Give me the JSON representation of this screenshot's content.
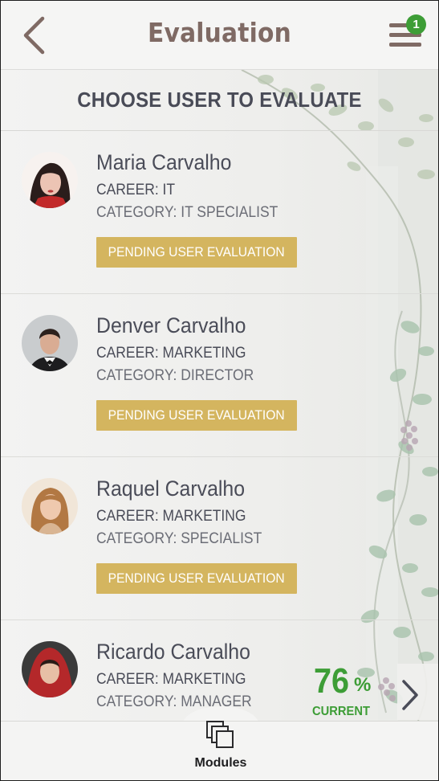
{
  "header": {
    "title": "Evaluation",
    "menu_badge_count": "1"
  },
  "section": {
    "title": "CHOOSE USER TO EVALUATE"
  },
  "users": [
    {
      "name": "Maria Carvalho",
      "career": "CAREER: IT",
      "category": "CATEGORY: IT SPECIALIST",
      "status": "PENDING USER EVALUATION"
    },
    {
      "name": "Denver Carvalho",
      "career": "CAREER: MARKETING",
      "category": "CATEGORY: DIRECTOR",
      "status": "PENDING USER EVALUATION"
    },
    {
      "name": "Raquel Carvalho",
      "career": "CAREER: MARKETING",
      "category": "CATEGORY: SPECIALIST",
      "status": "PENDING USER EVALUATION"
    },
    {
      "name": "Ricardo Carvalho",
      "career": "CAREER: MARKETING",
      "category": "CATEGORY: MANAGER"
    }
  ],
  "progress": {
    "value": "76",
    "unit": "%",
    "label": "CURRENT"
  },
  "bottom_nav": {
    "modules_label": "Modules"
  },
  "colors": {
    "accent_brown": "#7f6a64",
    "badge_green": "#3d9d36",
    "status_gold": "#d4b55f",
    "text_dark": "#4a4c58"
  },
  "icons": {
    "back": "chevron-left-icon",
    "menu": "hamburger-menu-icon",
    "next": "chevron-right-icon",
    "modules": "stacked-pages-icon"
  }
}
